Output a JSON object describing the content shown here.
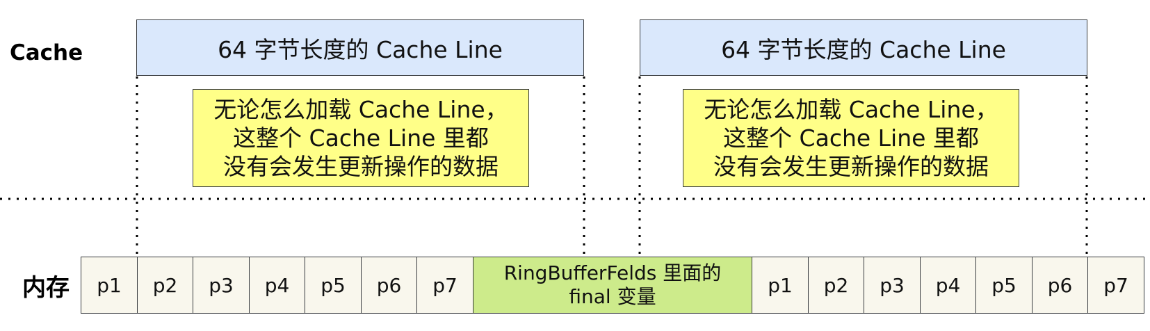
{
  "labels": {
    "cache": "Cache",
    "memory": "内存"
  },
  "cache_lines": [
    {
      "label": "64 字节长度的 Cache Line"
    },
    {
      "label": "64 字节长度的 Cache Line"
    }
  ],
  "notes": [
    {
      "lines": [
        "无论怎么加载 Cache Line，",
        "这整个 Cache Line 里都",
        "没有会发生更新操作的数据"
      ]
    },
    {
      "lines": [
        "无论怎么加载 Cache Line，",
        "这整个 Cache Line 里都",
        "没有会发生更新操作的数据"
      ]
    }
  ],
  "memory_cells": {
    "left": [
      "p1",
      "p2",
      "p3",
      "p4",
      "p5",
      "p6",
      "p7"
    ],
    "middle": [
      "RingBufferFelds 里面的",
      "final 变量"
    ],
    "right": [
      "p1",
      "p2",
      "p3",
      "p4",
      "p5",
      "p6",
      "p7"
    ]
  },
  "colors": {
    "cache_line_fill": "#dae8fc",
    "note_fill": "#ffff88",
    "memory_cell_fill": "#f9f7ed",
    "highlight_fill": "#cdeb8b",
    "border": "#36393d"
  }
}
